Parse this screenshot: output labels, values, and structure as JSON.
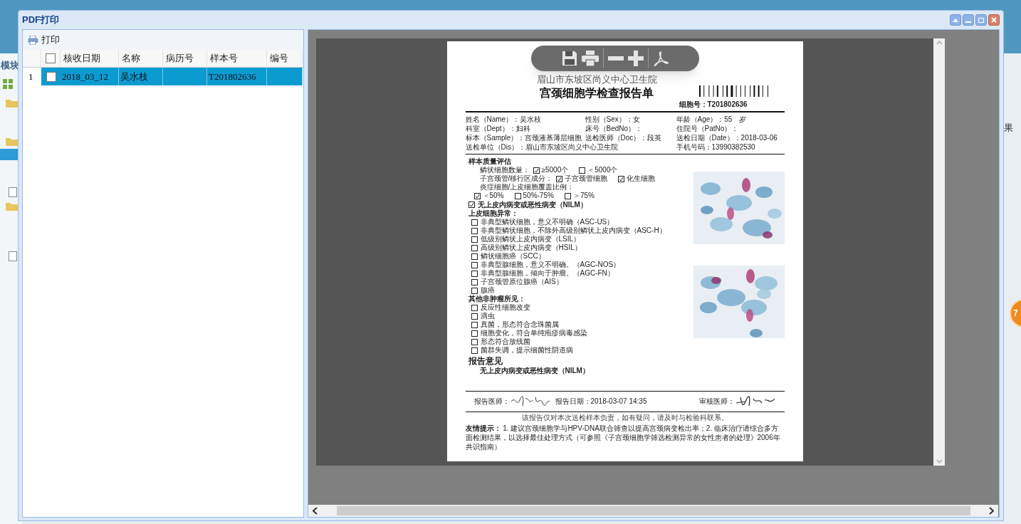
{
  "background": {
    "sidebar_label": "模块",
    "right_label": "果",
    "badge": "7"
  },
  "window": {
    "title": "PDF打印"
  },
  "toolbar": {
    "print_button": "打印"
  },
  "grid": {
    "select_all": {
      "checked": false
    },
    "columns": [
      "核收日期",
      "名称",
      "病历号",
      "样本号",
      "编号"
    ],
    "rows": [
      {
        "index": "1",
        "checked": false,
        "selected": true,
        "date": "2018_03_12",
        "name": "吴水枝",
        "sample_no": "T201802636"
      }
    ]
  },
  "report": {
    "hospital": "眉山市东坡区尚义中心卫生院",
    "title": "宫颈细胞学检查报告单",
    "cell_no": "细胞号：T201802636",
    "info": [
      [
        "姓名（Name）：吴水枝",
        "性别（Sex）：女",
        "年龄（Age）：55　岁"
      ],
      [
        "科室（Dept）：妇科",
        "床号（BedNo）：",
        "住院号（PatNo）："
      ],
      [
        "标本（Sample）：宫颈液基薄层细胞",
        "送检医师（Doc）：段英",
        "送检日期（Date）：2018-03-06"
      ],
      [
        "送检单位（Dis）：眉山市东坡区尚义中心卫生院",
        "手机号码：13990382530"
      ]
    ],
    "quality": {
      "heading": "样本质量评估",
      "lines": [
        {
          "label": "鳞状细胞数量：",
          "options": [
            {
              "label": "≥5000个",
              "checked": true
            },
            {
              "label": "＜5000个",
              "checked": false
            }
          ]
        },
        {
          "label": "子宫颈管/移行区成分：",
          "options": [
            {
              "label": "子宫颈管细胞",
              "checked": true
            },
            {
              "label": "化生细胞",
              "checked": true
            }
          ]
        },
        {
          "label": "炎症细胞/上皮细胞覆盖比例："
        },
        {
          "options": [
            {
              "label": "＜50%",
              "checked": true
            },
            {
              "label": "50%-75%",
              "checked": false
            },
            {
              "label": "＞75%",
              "checked": false
            }
          ]
        }
      ]
    },
    "nilm": {
      "label": "无上皮内病变或恶性病变（NILM）",
      "checked": true
    },
    "groups": [
      {
        "heading": "上皮细胞异常：",
        "items": [
          {
            "label": "非典型鳞状细胞，意义不明确（ASC-US）",
            "checked": false
          },
          {
            "label": "非典型鳞状细胞，不除外高级别鳞状上皮内病变（ASC-H）",
            "checked": false
          },
          {
            "label": "低级别鳞状上皮内病变（LSIL）",
            "checked": false
          },
          {
            "label": "高级别鳞状上皮内病变（HSIL）",
            "checked": false
          },
          {
            "label": "鳞状细胞癌（SCC）",
            "checked": false
          },
          {
            "label": "非典型腺细胞，意义不明确。（AGC-NOS）",
            "checked": false
          },
          {
            "label": "非典型腺细胞，倾向于肿瘤。（AGC-FN）",
            "checked": false
          },
          {
            "label": "子宫颈管原位腺癌（AIS）",
            "checked": false
          },
          {
            "label": "腺癌",
            "checked": false
          }
        ]
      },
      {
        "heading": "其他非肿瘤所见：",
        "items": [
          {
            "label": "反应性细胞改变",
            "checked": false
          },
          {
            "label": "滴虫",
            "checked": false
          },
          {
            "label": "真菌，形态符合念珠菌属",
            "checked": false
          },
          {
            "label": "细胞变化，符合单纯疱疹病毒感染",
            "checked": false
          },
          {
            "label": "形态符合放线菌",
            "checked": false
          },
          {
            "label": "菌群失调，提示细菌性阴道病",
            "checked": false
          }
        ]
      }
    ],
    "opinion": {
      "heading": "报告意见",
      "text": "无上皮内病变或恶性病变（NILM）"
    },
    "footer": {
      "reporter_label": "报告医师：",
      "report_date": "报告日期：2018-03-07 14:35",
      "reviewer_label": "审核医师：",
      "disclaimer": "该报告仅对本次送检样本负责，如有疑问，请及时与检验科联系。",
      "tips": "**友情提示：** 1. 建议宫颈细胞学与HPV-DNA联合筛查以提高宫颈病变检出率；2. 临床治疗请综合多方面检测结果，以选择最佳处理方式（可参照《子宫颈细胞学筛选检测异常的女性患者的处理》2006年共识指南）"
    }
  }
}
